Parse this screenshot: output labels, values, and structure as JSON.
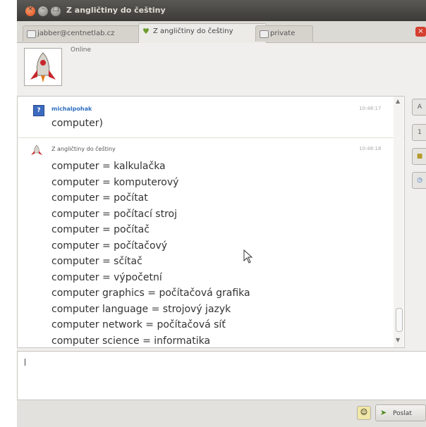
{
  "window": {
    "title": "Z angličtiny do češtiny",
    "close_glyph": "×",
    "min_glyph": "–",
    "max_glyph": "□"
  },
  "tabs": [
    {
      "label": "jabber@centnetlab.cz",
      "icon": "chat-tab-icon"
    },
    {
      "label": "Z angličtiny do češtiny",
      "icon": "bot-tab-icon",
      "active": true
    },
    {
      "label": "private",
      "icon": "chat-tab-icon"
    }
  ],
  "tab_close_glyph": "×",
  "header": {
    "status": "Online",
    "avatar_icon": "rocket-avatar-icon"
  },
  "messages": [
    {
      "sender": "michalpohak",
      "time": "10:48:17",
      "lines": [
        "computer)"
      ],
      "avatar_icon": "unknown-user-icon"
    },
    {
      "sender": "Z angličtiny do češtiny",
      "time": "10:48:18",
      "avatar_icon": "rocket-avatar-icon",
      "lines": [
        "computer = kalkulačka",
        "computer = komputerový",
        "computer = počítat",
        "computer = počítací stroj",
        "computer = počítač",
        "computer = počítačový",
        "computer = sčítač",
        "computer = výpočetní",
        "computer graphics = počítačová grafika",
        "computer language = strojový jazyk",
        "computer network = počítačová síť",
        "computer science = informatika"
      ]
    }
  ],
  "side_buttons": [
    "A",
    "1",
    "",
    ""
  ],
  "input": {
    "value": ""
  },
  "send_button": {
    "label": "Poslat"
  },
  "colors": {
    "titlebar": "#3c3b37",
    "link": "#2f6fbf",
    "send_icon": "#4a8a1e"
  }
}
